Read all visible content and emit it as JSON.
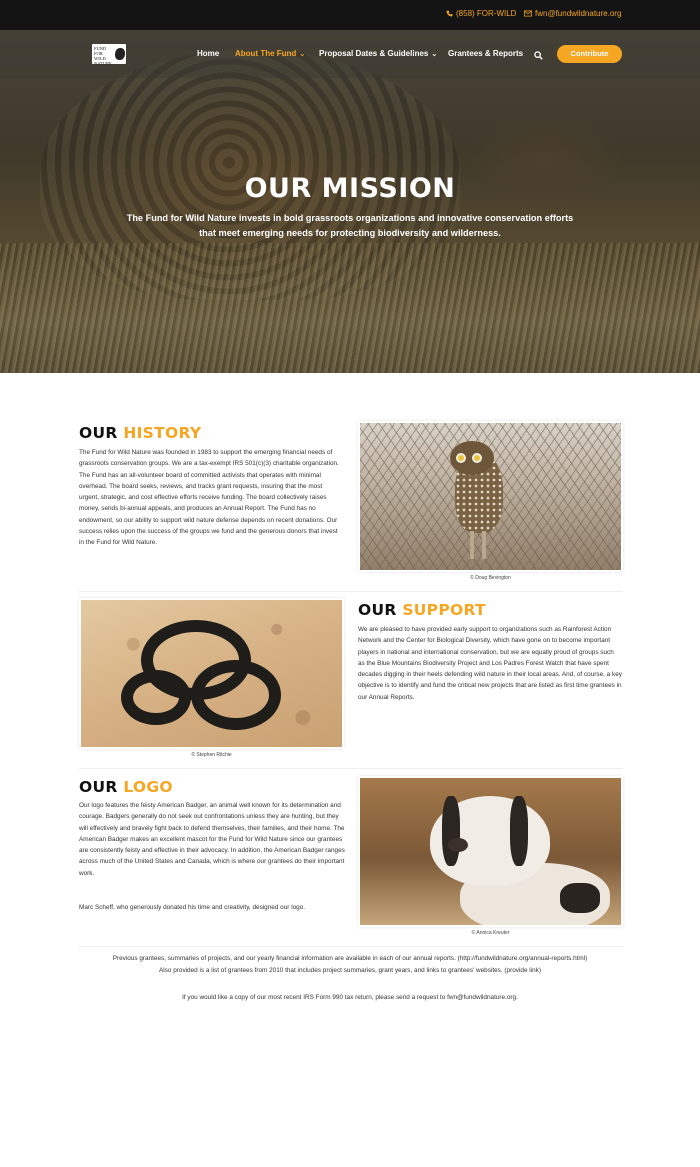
{
  "topbar": {
    "phone": "(858) FOR-WILD",
    "email": "fwn@fundwildnature.org"
  },
  "nav": {
    "logo_text": "FUND FOR WILD NATURE",
    "items": [
      {
        "label": "Home",
        "active": false,
        "has_dropdown": false
      },
      {
        "label": "About The Fund",
        "active": true,
        "has_dropdown": true
      },
      {
        "label": "Proposal Dates & Guidelines",
        "active": false,
        "has_dropdown": true
      },
      {
        "label": "Grantees & Reports",
        "active": false,
        "has_dropdown": false
      }
    ],
    "contribute_label": "Contribute"
  },
  "hero": {
    "title": "OUR MISSION",
    "subtitle": "The Fund for Wild Nature invests in bold grassroots organizations and innovative conservation efforts that meet emerging needs for protecting biodiversity and wilderness."
  },
  "sections": {
    "history": {
      "title_main": "OUR",
      "title_accent": "HISTORY",
      "body": "The Fund for Wild Nature was founded in 1983 to support the emerging financial needs of grassroots conservation groups. We are a tax-exempt IRS 501(c)(3) charitable organization. The Fund has an all-volunteer board of committed activists that operates with minimal overhead. The board seeks, reviews, and tracks grant requests, insuring that the most urgent, strategic, and cost effective efforts receive funding. The board collectively raises money, sends bi-annual appeals, and produces an Annual Report. The Fund has no endowment, so our ability to support wild nature defense depends on recent donations. Our success relies upon the success of the groups we fund and the generous donors that invest in the Fund for Wild Nature.",
      "caption": "© Doug Bevington"
    },
    "support": {
      "title_main": "OUR",
      "title_accent": "SUPPORT",
      "body": "We are pleased to have provided early support to organizations such as Rainforest Action Network and the Center for Biological Diversity, which have gone on to become important players in national and international conservation, but we are equally proud of groups such as the Blue Mountains Biodiversity Project and Los Padres Forest Watch that have spent decades digging in their heels defending wild nature in their local areas. And, of course, a key objective is to identify and fund the critical new projects that are listed as first time grantees in our Annual Reports.",
      "caption": "© Stephen Ritchie"
    },
    "logo": {
      "title_main": "OUR",
      "title_accent": "LOGO",
      "body": "Our logo features the feisty American Badger, an animal well known for its determination and courage. Badgers generally do not seek out confrontations unless they are hunting, but they will effectively and bravely fight back to defend themselves, their families, and their home. The American Badger makes an excellent mascot for the Fund for Wild Nature since our grantees are consistently feisty and effective in their advocacy. In addition, the American Badger ranges across much of the United States and Canada, which is where our grantees do their important work.",
      "body2": "Marc Scheff, who generously donated his time and creativity, designed our logo.",
      "caption": "© Annica Kreuter"
    }
  },
  "footer": {
    "line1": "Previous grantees, summaries of projects, and our yearly financial information are available in each of our annual reports. (http://fundwildnature.org/annual-reports.html)",
    "line2": "Also provided is a list of grantees from 2010 that includes project summaries, grant years, and links to grantees' websites. (provide link)",
    "line3": "If you would like a copy of our most recent IRS Form 990 tax return, please send a request to fwn@fundwildnature.org."
  },
  "colors": {
    "accent": "#f5a623",
    "topbar": "#141414"
  },
  "icons": {
    "phone": "phone-icon",
    "email": "envelope-icon",
    "search": "search-icon"
  }
}
